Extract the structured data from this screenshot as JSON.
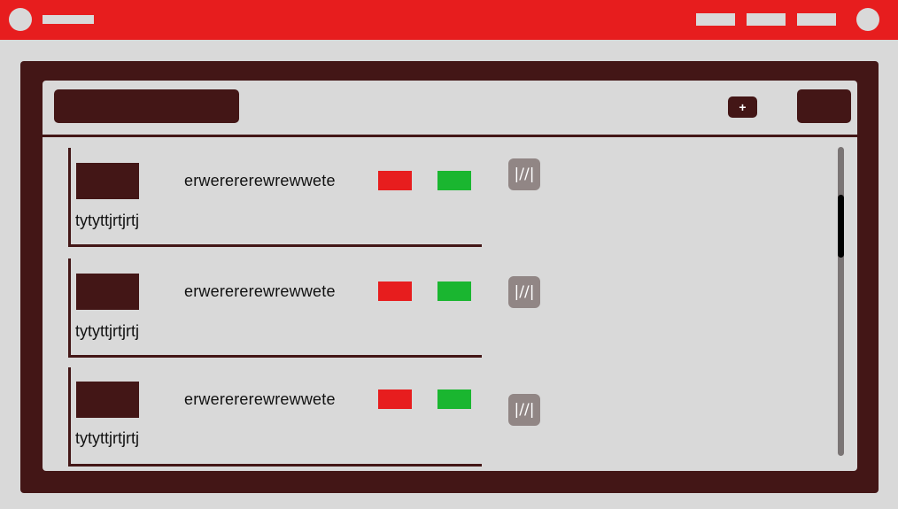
{
  "header": {
    "add_label": "+"
  },
  "cards": [
    {
      "title": "erwerererewrewwete",
      "subtitle": "tytyttjrtjrtj",
      "edit_icon": "|//|"
    },
    {
      "title": "erwerererewrewwete",
      "subtitle": "tytyttjrtjrtj",
      "edit_icon": "|//|"
    },
    {
      "title": "erwerererewrewwete",
      "subtitle": "tytyttjrtjrtj",
      "edit_icon": "|//|"
    }
  ],
  "colors": {
    "topbar": "#e71d1e",
    "frame": "#431616",
    "panel": "#d9d9d9",
    "red_swatch": "#e71d1e",
    "green_swatch": "#1ab630",
    "edit_button": "#918685"
  },
  "icons": {
    "edit": "edit-icon"
  }
}
